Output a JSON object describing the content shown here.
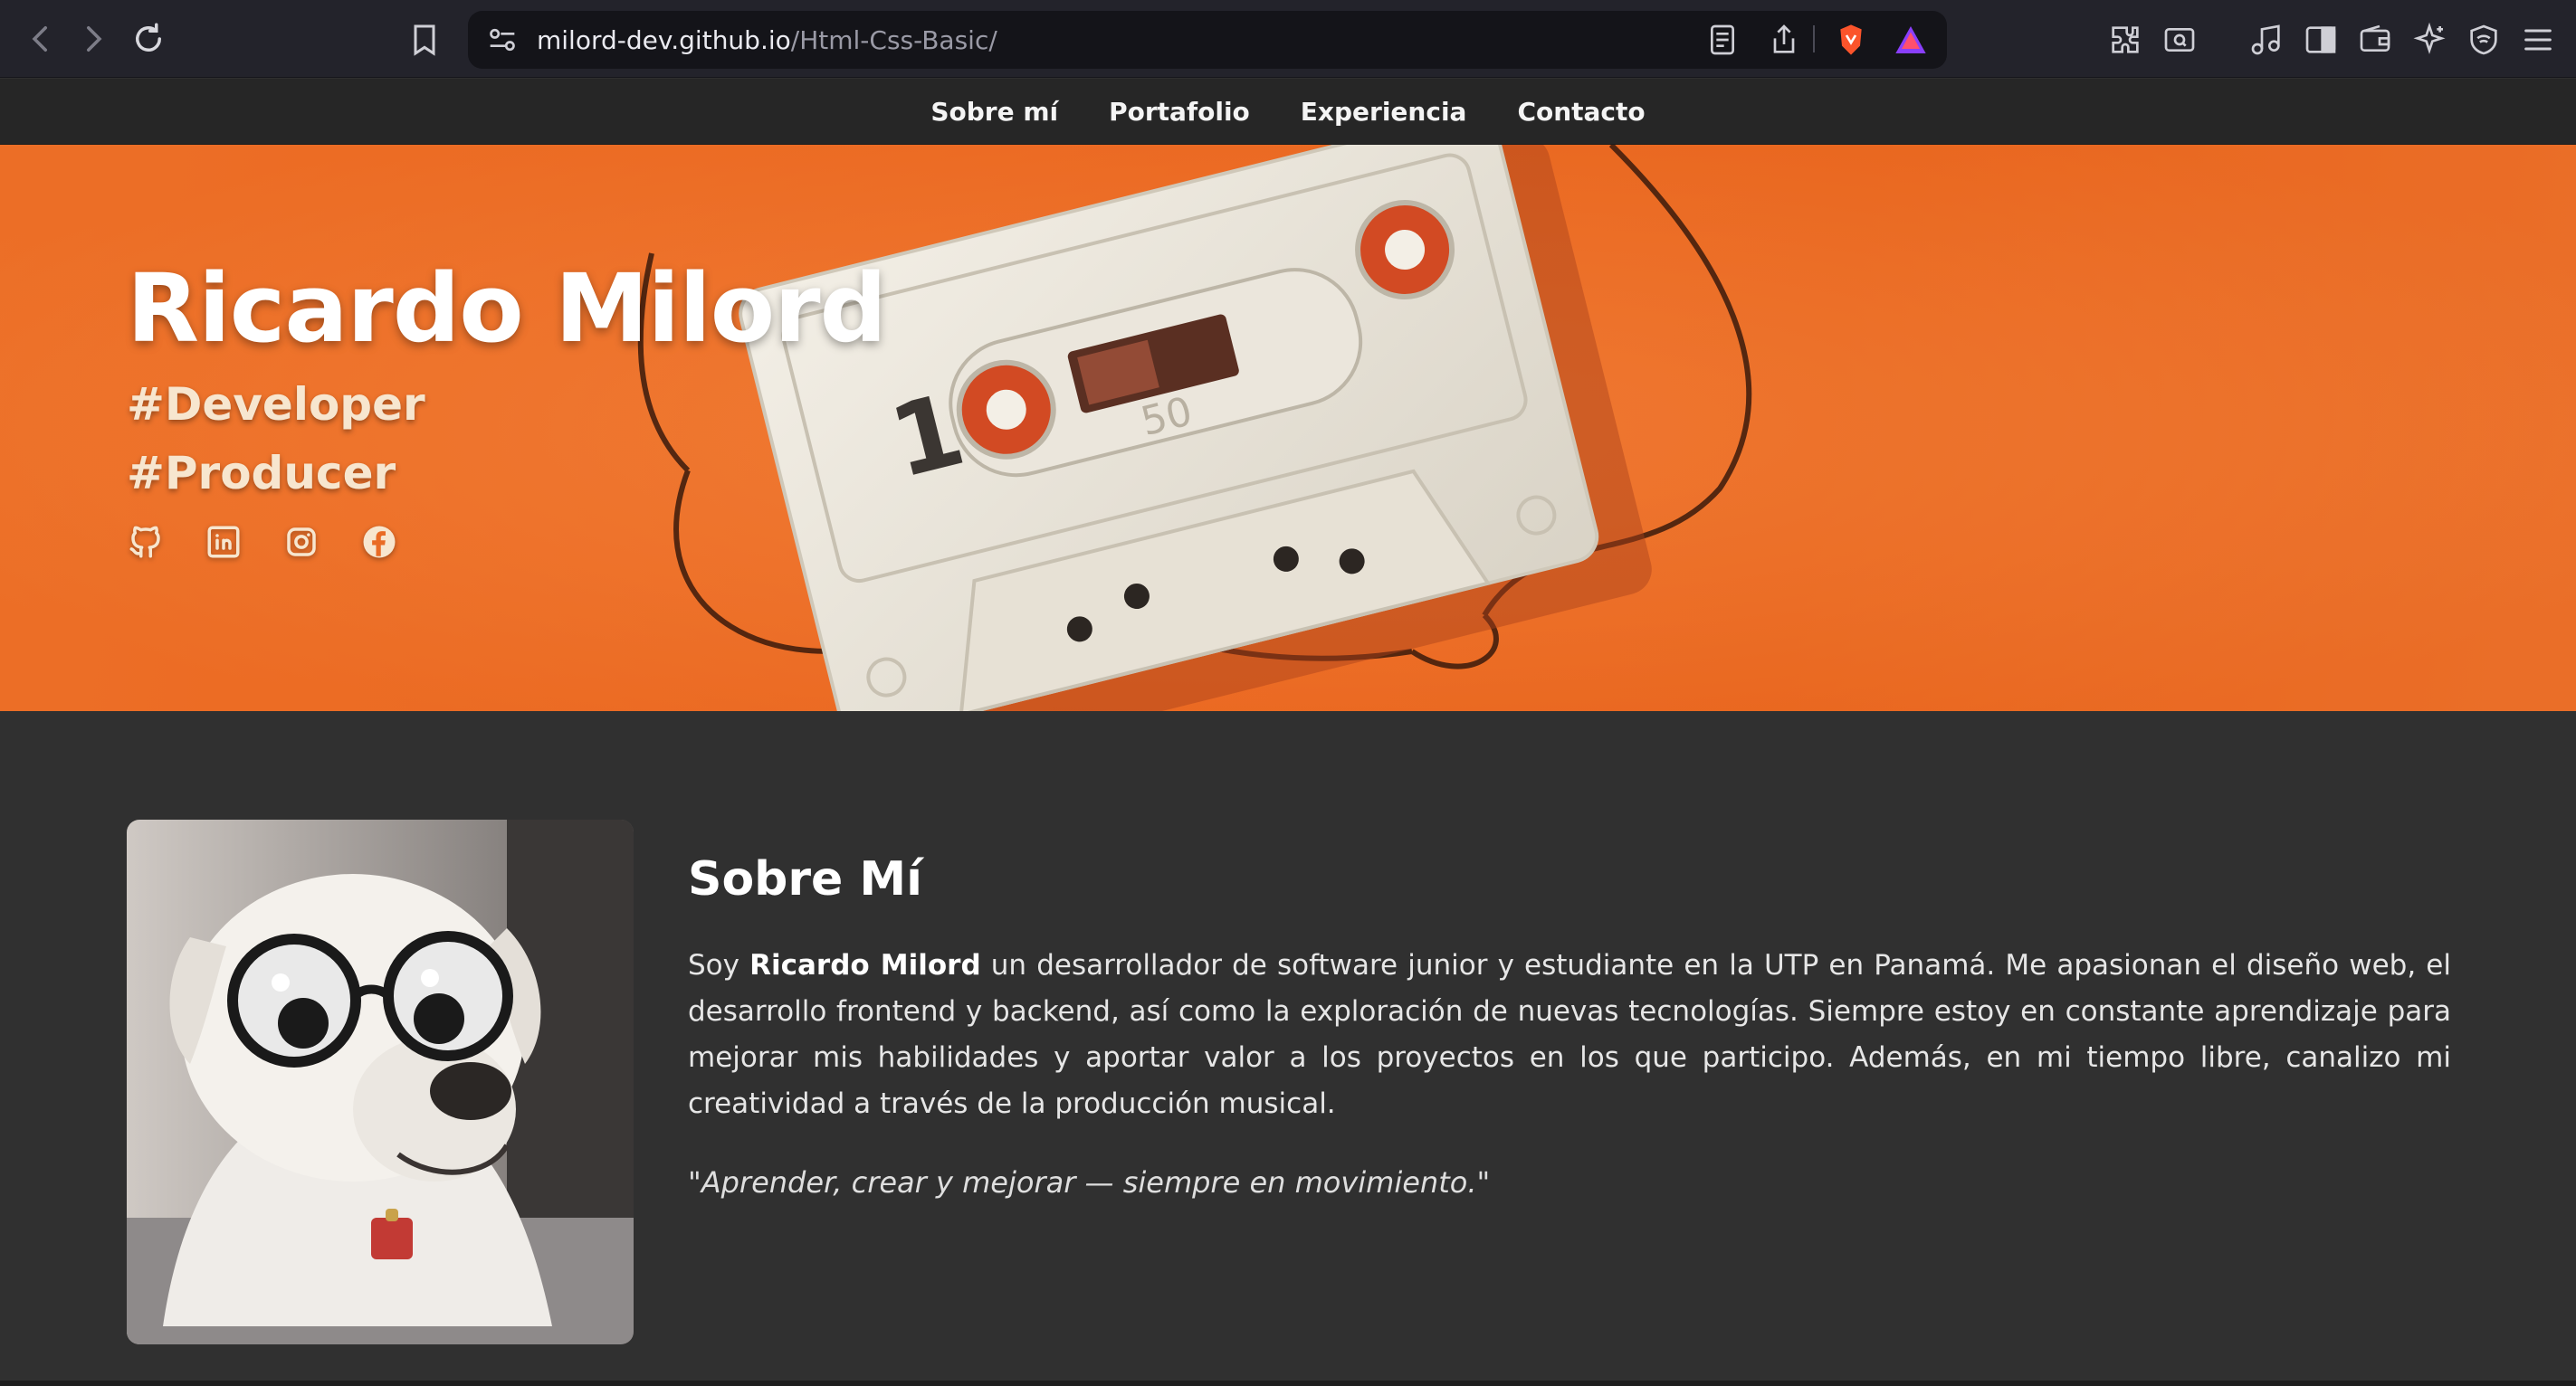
{
  "browser": {
    "url_domain": "milord-dev.github.io",
    "url_path": "/Html-Css-Basic/"
  },
  "nav": {
    "items": [
      "Sobre mí",
      "Portafolio",
      "Experiencia",
      "Contacto"
    ]
  },
  "hero": {
    "title": "Ricardo Milord",
    "tags": [
      "#Developer",
      "#Producer"
    ],
    "socials": [
      "github-icon",
      "linkedin-icon",
      "instagram-icon",
      "facebook-icon"
    ],
    "cassette_side": "1",
    "cassette_counter": "50"
  },
  "about": {
    "title": "Sobre Mí",
    "text_before": "Soy ",
    "name": "Ricardo Milord",
    "text_after": " un desarrollador de software junior y estudiante en la UTP en Panamá. Me apasionan el diseño web, el desarrollo frontend y backend, así como la exploración de nuevas tecnologías. Siempre estoy en constante aprendizaje para mejorar mis habilidades y aportar valor a los proyectos en los que participo. Además, en mi tiempo libre, canalizo mi creatividad a través de la producción musical.",
    "quote": "\"Aprender, crear y mejorar — siempre en movimiento.\""
  },
  "colors": {
    "hero_orange": "#ec6a22",
    "page_bg": "#303030",
    "nav_bg": "#262626",
    "chrome_bg": "#23232b"
  }
}
